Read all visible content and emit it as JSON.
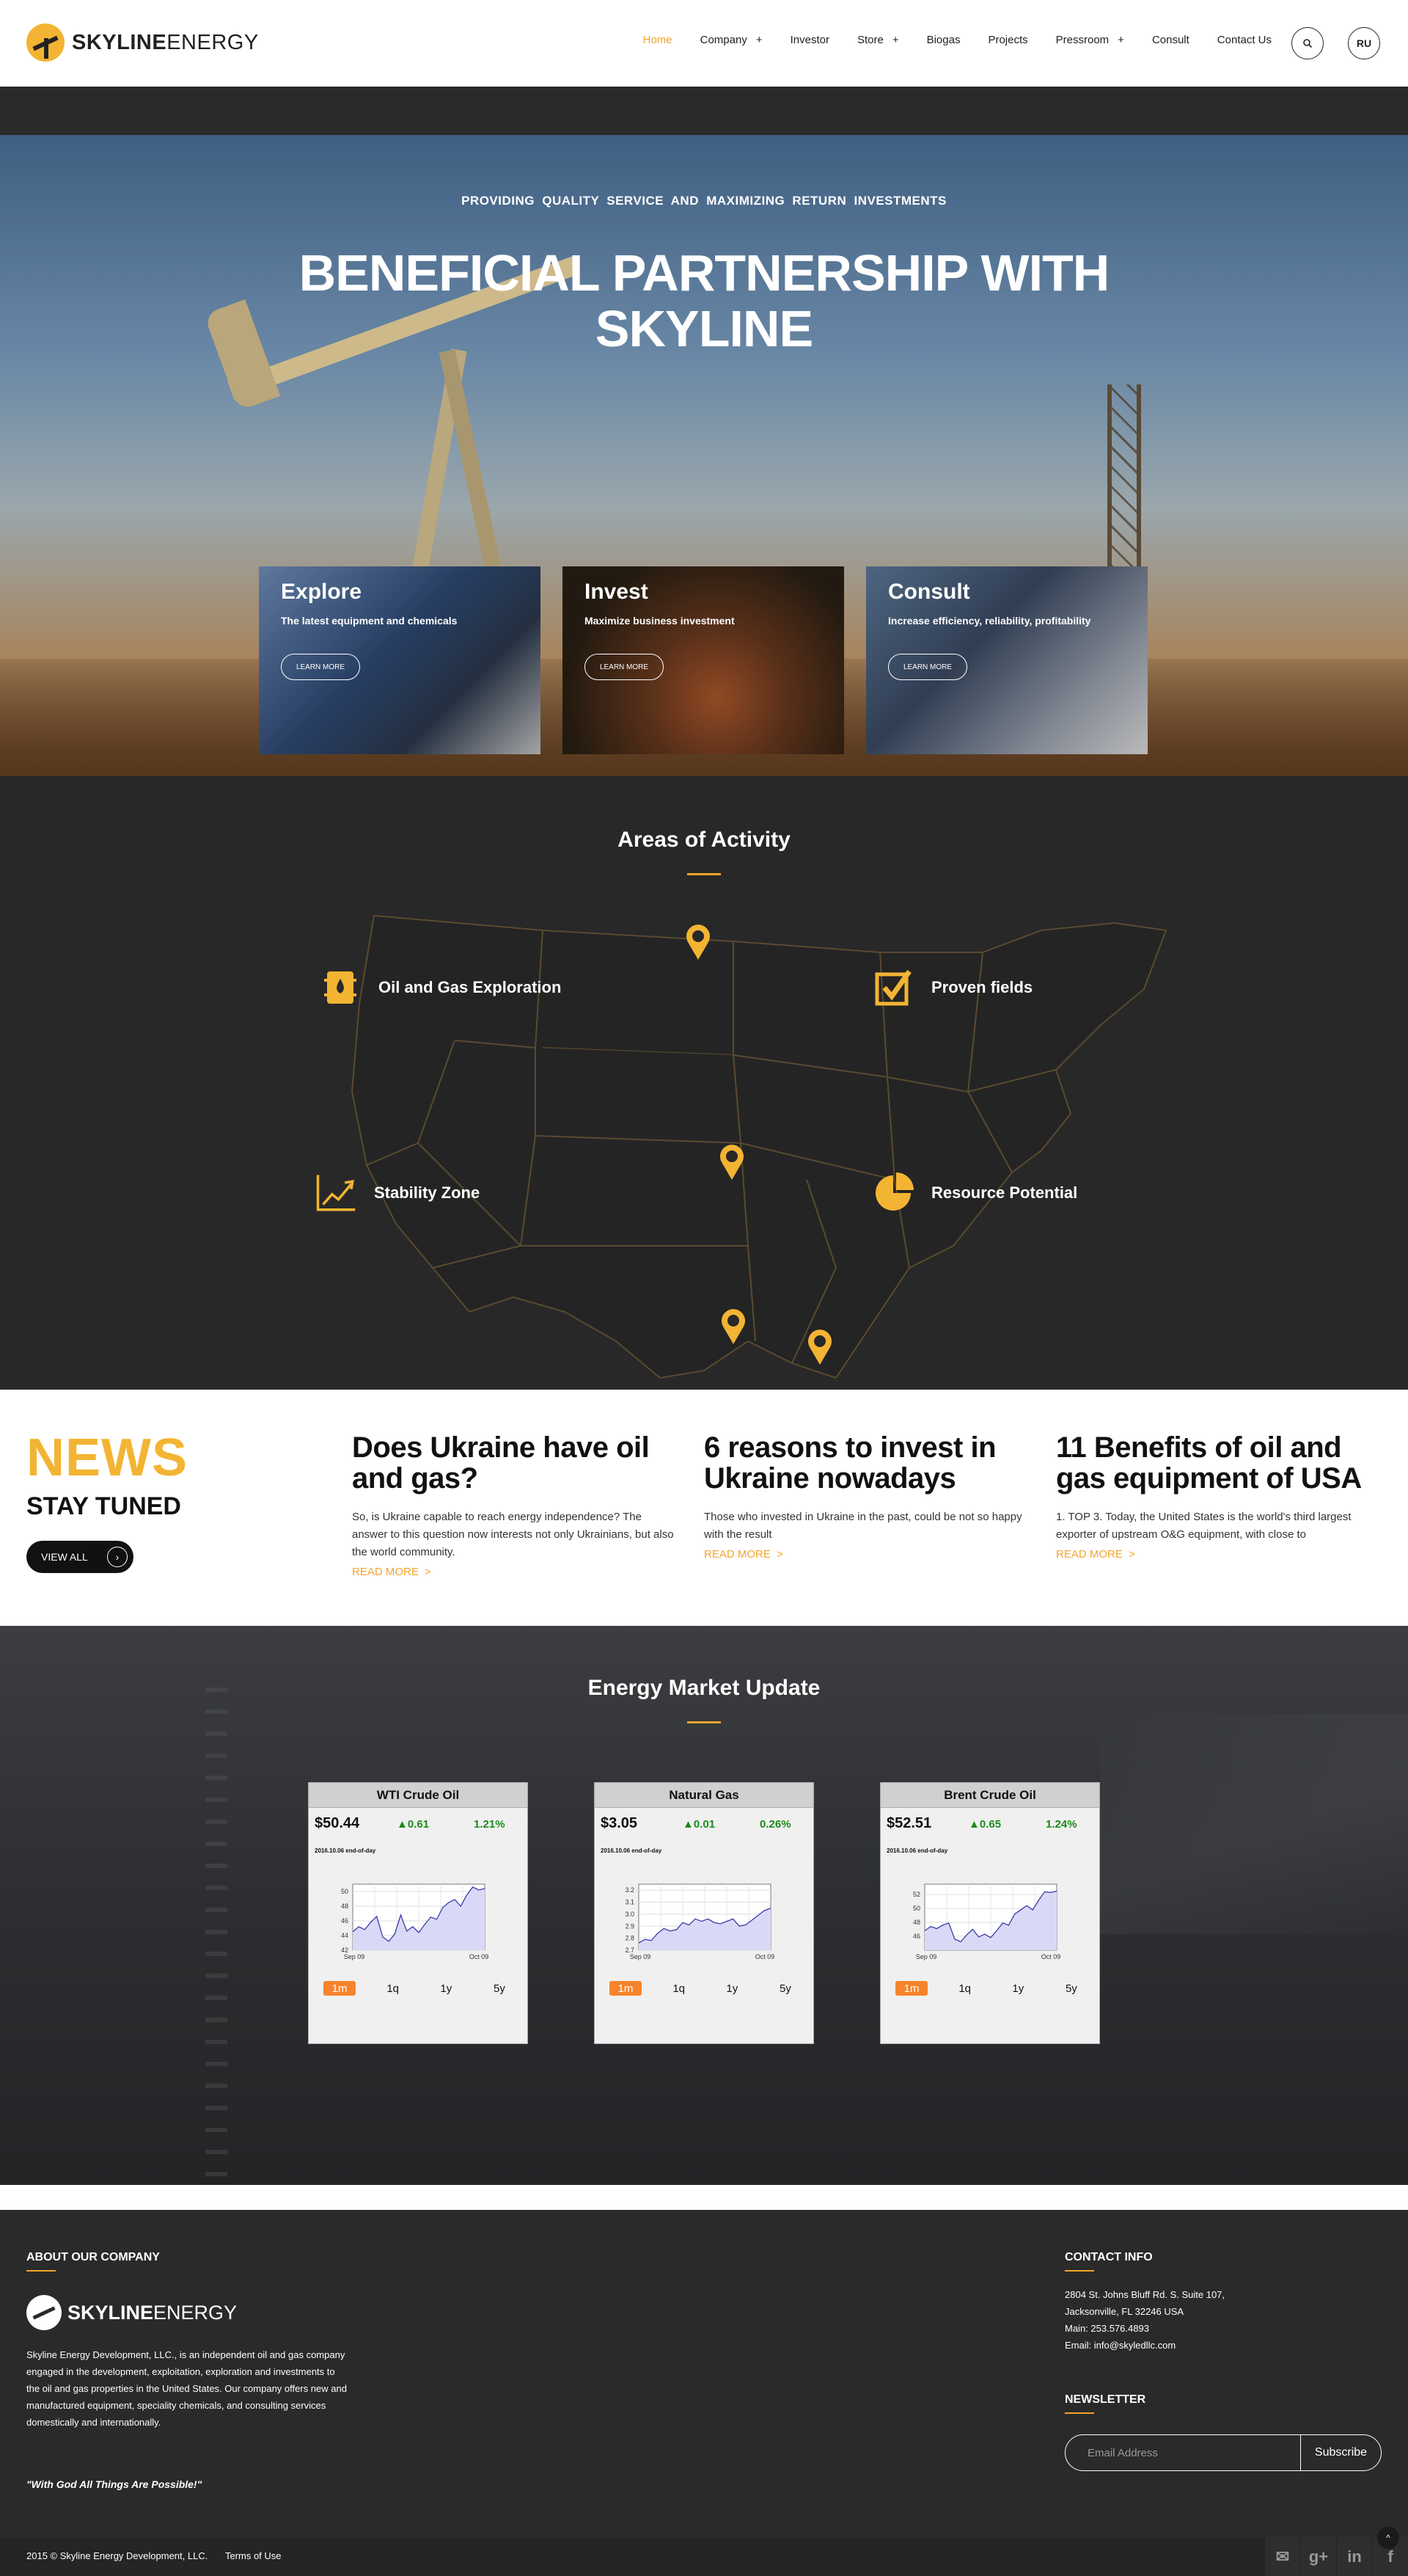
{
  "header": {
    "logo_bold": "SKYLINE",
    "logo_light": "ENERGY",
    "nav": [
      {
        "label": "Home",
        "active": true,
        "submenu": false
      },
      {
        "label": "Company",
        "active": false,
        "submenu": true
      },
      {
        "label": "Investor",
        "active": false,
        "submenu": false
      },
      {
        "label": "Store",
        "active": false,
        "submenu": true
      },
      {
        "label": "Biogas",
        "active": false,
        "submenu": false
      },
      {
        "label": "Projects",
        "active": false,
        "submenu": false
      },
      {
        "label": "Pressroom",
        "active": false,
        "submenu": true
      },
      {
        "label": "Consult",
        "active": false,
        "submenu": false
      },
      {
        "label": "Contact Us",
        "active": false,
        "submenu": false
      }
    ],
    "submenu_glyph": "+",
    "search_icon": "search-icon",
    "lang_label": "RU"
  },
  "hero": {
    "subtitle": "PROVIDING QUALITY SERVICE AND MAXIMIZING RETURN INVESTMENTS",
    "title_line1": "BENEFICIAL PARTNERSHIP WITH",
    "title_line2": "SKYLINE",
    "cards": [
      {
        "title": "Explore",
        "desc": "The latest equipment and chemicals",
        "button": "LEARN MORE"
      },
      {
        "title": "Invest",
        "desc": "Maximize business investment",
        "button": "LEARN MORE"
      },
      {
        "title": "Consult",
        "desc": "Increase efficiency, reliability, profitability",
        "button": "LEARN MORE"
      }
    ]
  },
  "areas": {
    "title": "Areas of Activity",
    "items": [
      {
        "label": "Oil and Gas Exploration",
        "icon": "oil-barrel-icon"
      },
      {
        "label": "Proven fields",
        "icon": "checkbox-icon"
      },
      {
        "label": "Stability Zone",
        "icon": "growth-chart-icon"
      },
      {
        "label": "Resource Potential",
        "icon": "pie-chart-icon"
      }
    ]
  },
  "news": {
    "heading": "NEWS",
    "subheading": "STAY TUNED",
    "view_all": "VIEW ALL",
    "read_more": "READ MORE",
    "articles": [
      {
        "title": "Does Ukraine have oil and gas?",
        "excerpt": "So, is Ukraine capable to reach energy independence? The answer to this question now interests not only Ukrainians, but also the world community."
      },
      {
        "title": "6 reasons to invest in Ukraine nowadays",
        "excerpt": "Those who invested in Ukraine in the past, could be not so happy with the result"
      },
      {
        "title": "11 Benefits of oil and gas equipment of USA",
        "excerpt": "1. TOP 3. Today, the United States is the world's third largest exporter of upstream O&G equipment, with close to"
      }
    ]
  },
  "energy": {
    "title": "Energy Market Update",
    "tabs": [
      "1m",
      "1q",
      "1y",
      "5y"
    ],
    "active_tab": "1m",
    "widgets": [
      {
        "name": "WTI Crude Oil",
        "price": "$50.44",
        "change": "▲0.61",
        "pct": "1.21%",
        "date": "2016.10.06 end-of-day"
      },
      {
        "name": "Natural Gas",
        "price": "$3.05",
        "change": "▲0.01",
        "pct": "0.26%",
        "date": "2016.10.06 end-of-day"
      },
      {
        "name": "Brent Crude Oil",
        "price": "$52.51",
        "change": "▲0.65",
        "pct": "1.24%",
        "date": "2016.10.06 end-of-day"
      }
    ],
    "accent_up": "#1a8a1a",
    "tab_active_color": "#f7842c"
  },
  "chart_data": [
    {
      "type": "area",
      "series": [
        {
          "values": [
            44.5,
            45.2,
            44.8,
            45.8,
            46.6,
            43.8,
            43.2,
            44.2,
            46.8,
            44.6,
            45.2,
            44.4,
            45.5,
            46.5,
            46.2,
            47.8,
            48.5,
            48.9,
            48.0,
            49.5,
            50.6,
            50.2,
            50.4
          ]
        }
      ],
      "ylim": [
        42,
        51
      ],
      "yticks": [
        "42",
        "44",
        "46",
        "48",
        "50"
      ],
      "xticks": [
        "Sep 09",
        "Oct 09"
      ]
    },
    {
      "type": "area",
      "series": [
        {
          "values": [
            2.76,
            2.79,
            2.78,
            2.84,
            2.88,
            2.86,
            2.87,
            2.93,
            2.91,
            2.96,
            2.94,
            2.96,
            2.93,
            2.92,
            2.94,
            2.96,
            2.9,
            2.91,
            2.95,
            2.99,
            3.03,
            3.05
          ]
        }
      ],
      "ylim": [
        2.7,
        3.25
      ],
      "yticks": [
        "2.7",
        "2.8",
        "2.9",
        "3.0",
        "3.1",
        "3.2"
      ],
      "xticks": [
        "Sep 09",
        "Oct 09"
      ]
    },
    {
      "type": "area",
      "series": [
        {
          "values": [
            46.8,
            47.4,
            47.1,
            47.6,
            47.9,
            45.6,
            45.2,
            46.2,
            47.0,
            45.9,
            46.3,
            45.8,
            46.8,
            47.9,
            47.6,
            49.2,
            49.8,
            50.4,
            49.8,
            51.2,
            52.4,
            52.3,
            52.5
          ]
        }
      ],
      "ylim": [
        44,
        53.5
      ],
      "yticks": [
        "46",
        "48",
        "50",
        "52"
      ],
      "xticks": [
        "Sep 09",
        "Oct 09"
      ]
    }
  ],
  "footer": {
    "about_title": "ABOUT OUR COMPANY",
    "logo_bold": "SKYLINE",
    "logo_light": "ENERGY",
    "about_text": "Skyline Energy Development, LLC., is an independent oil and gas company engaged in the development, exploitation, exploration and investments to the oil and gas properties in the United States. Our company offers new and manufactured equipment, speciality chemicals, and consulting services domestically and internationally.",
    "quote": "\"With God All Things Are Possible!\"",
    "contact_title": "CONTACT INFO",
    "contact_lines": [
      "2804 St. Johns Bluff Rd. S. Suite 107,",
      "Jacksonville, FL 32246 USA",
      "Main: 253.576.4893",
      "Email: info@skyledllc.com"
    ],
    "newsletter_title": "NEWSLETTER",
    "newsletter_placeholder": "Email Address",
    "subscribe_label": "Subscribe",
    "copyright": "2015 © Skyline Energy Development, LLC.",
    "terms": "Terms of Use",
    "social": [
      {
        "icon": "mail-icon",
        "glyph": "✉"
      },
      {
        "icon": "google-plus-icon",
        "glyph": "g+"
      },
      {
        "icon": "linkedin-icon",
        "glyph": "in"
      },
      {
        "icon": "facebook-icon",
        "glyph": "f"
      }
    ],
    "to_top_glyph": "^"
  }
}
